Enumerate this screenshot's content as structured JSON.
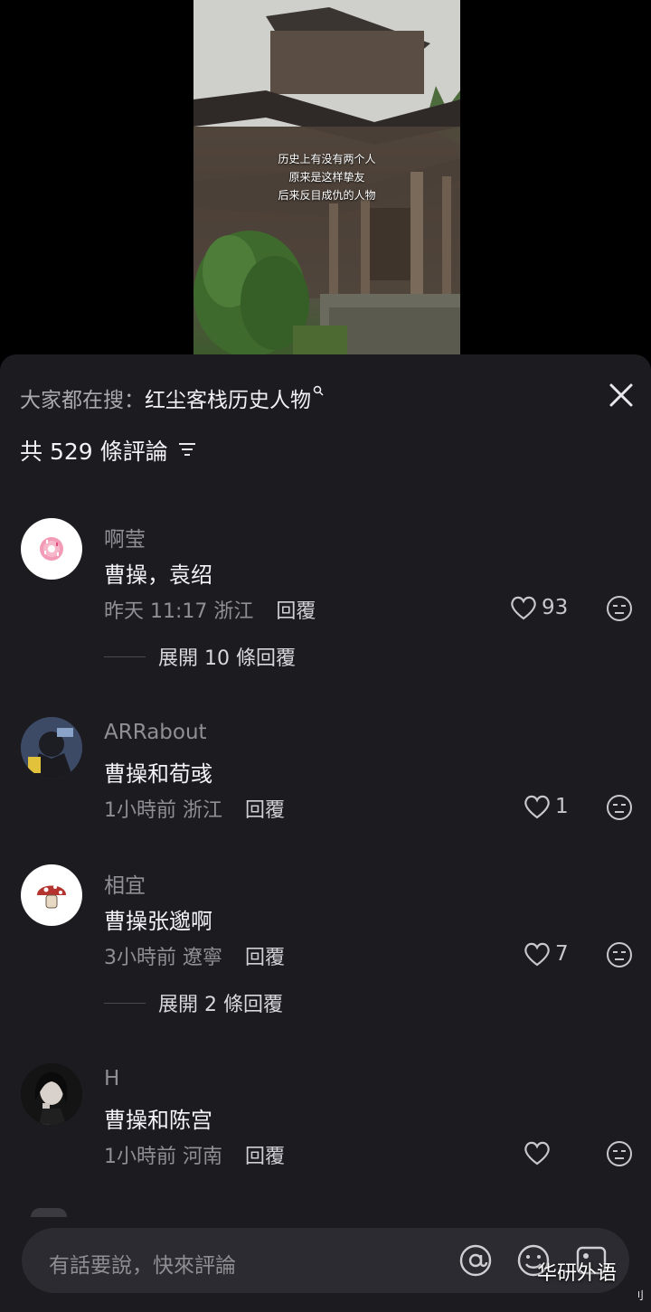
{
  "video": {
    "caption_lines": [
      "历史上有没有两个人",
      "原来是这样挚友",
      "后来反目成仇的人物"
    ]
  },
  "sheet": {
    "search_prefix": "大家都在搜：",
    "search_term": "红尘客栈历史人物",
    "search_icon": "search-icon",
    "close_icon": "close-icon",
    "comment_count": "共 529 條評論",
    "sort_icon": "sort-filter-icon"
  },
  "comments": [
    {
      "username": "啊莹",
      "text": "曹操，袁绍",
      "time": "昨天 11:17",
      "location": "浙江",
      "reply_label": "回覆",
      "likes": "93",
      "expand_label": "展開 10 條回覆"
    },
    {
      "username": "ARRabout",
      "text": "曹操和荀彧",
      "time": "1小時前",
      "location": "浙江",
      "reply_label": "回覆",
      "likes": "1"
    },
    {
      "username": "相宜",
      "text": "曹操张邈啊",
      "time": "3小時前",
      "location": "遼寧",
      "reply_label": "回覆",
      "likes": "7",
      "expand_label": "展開 2 條回覆"
    },
    {
      "username": "H",
      "text": "曹操和陈宫",
      "time": "1小時前",
      "location": "河南",
      "reply_label": "回覆",
      "likes": ""
    }
  ],
  "input": {
    "placeholder": "有話要說，快來評論"
  },
  "watermark": "华研外语",
  "watermark_small": "刂",
  "colors": {
    "sheet_bg": "#1b1b20",
    "text_primary": "#f4f4f6",
    "text_secondary": "#8f8f95"
  }
}
